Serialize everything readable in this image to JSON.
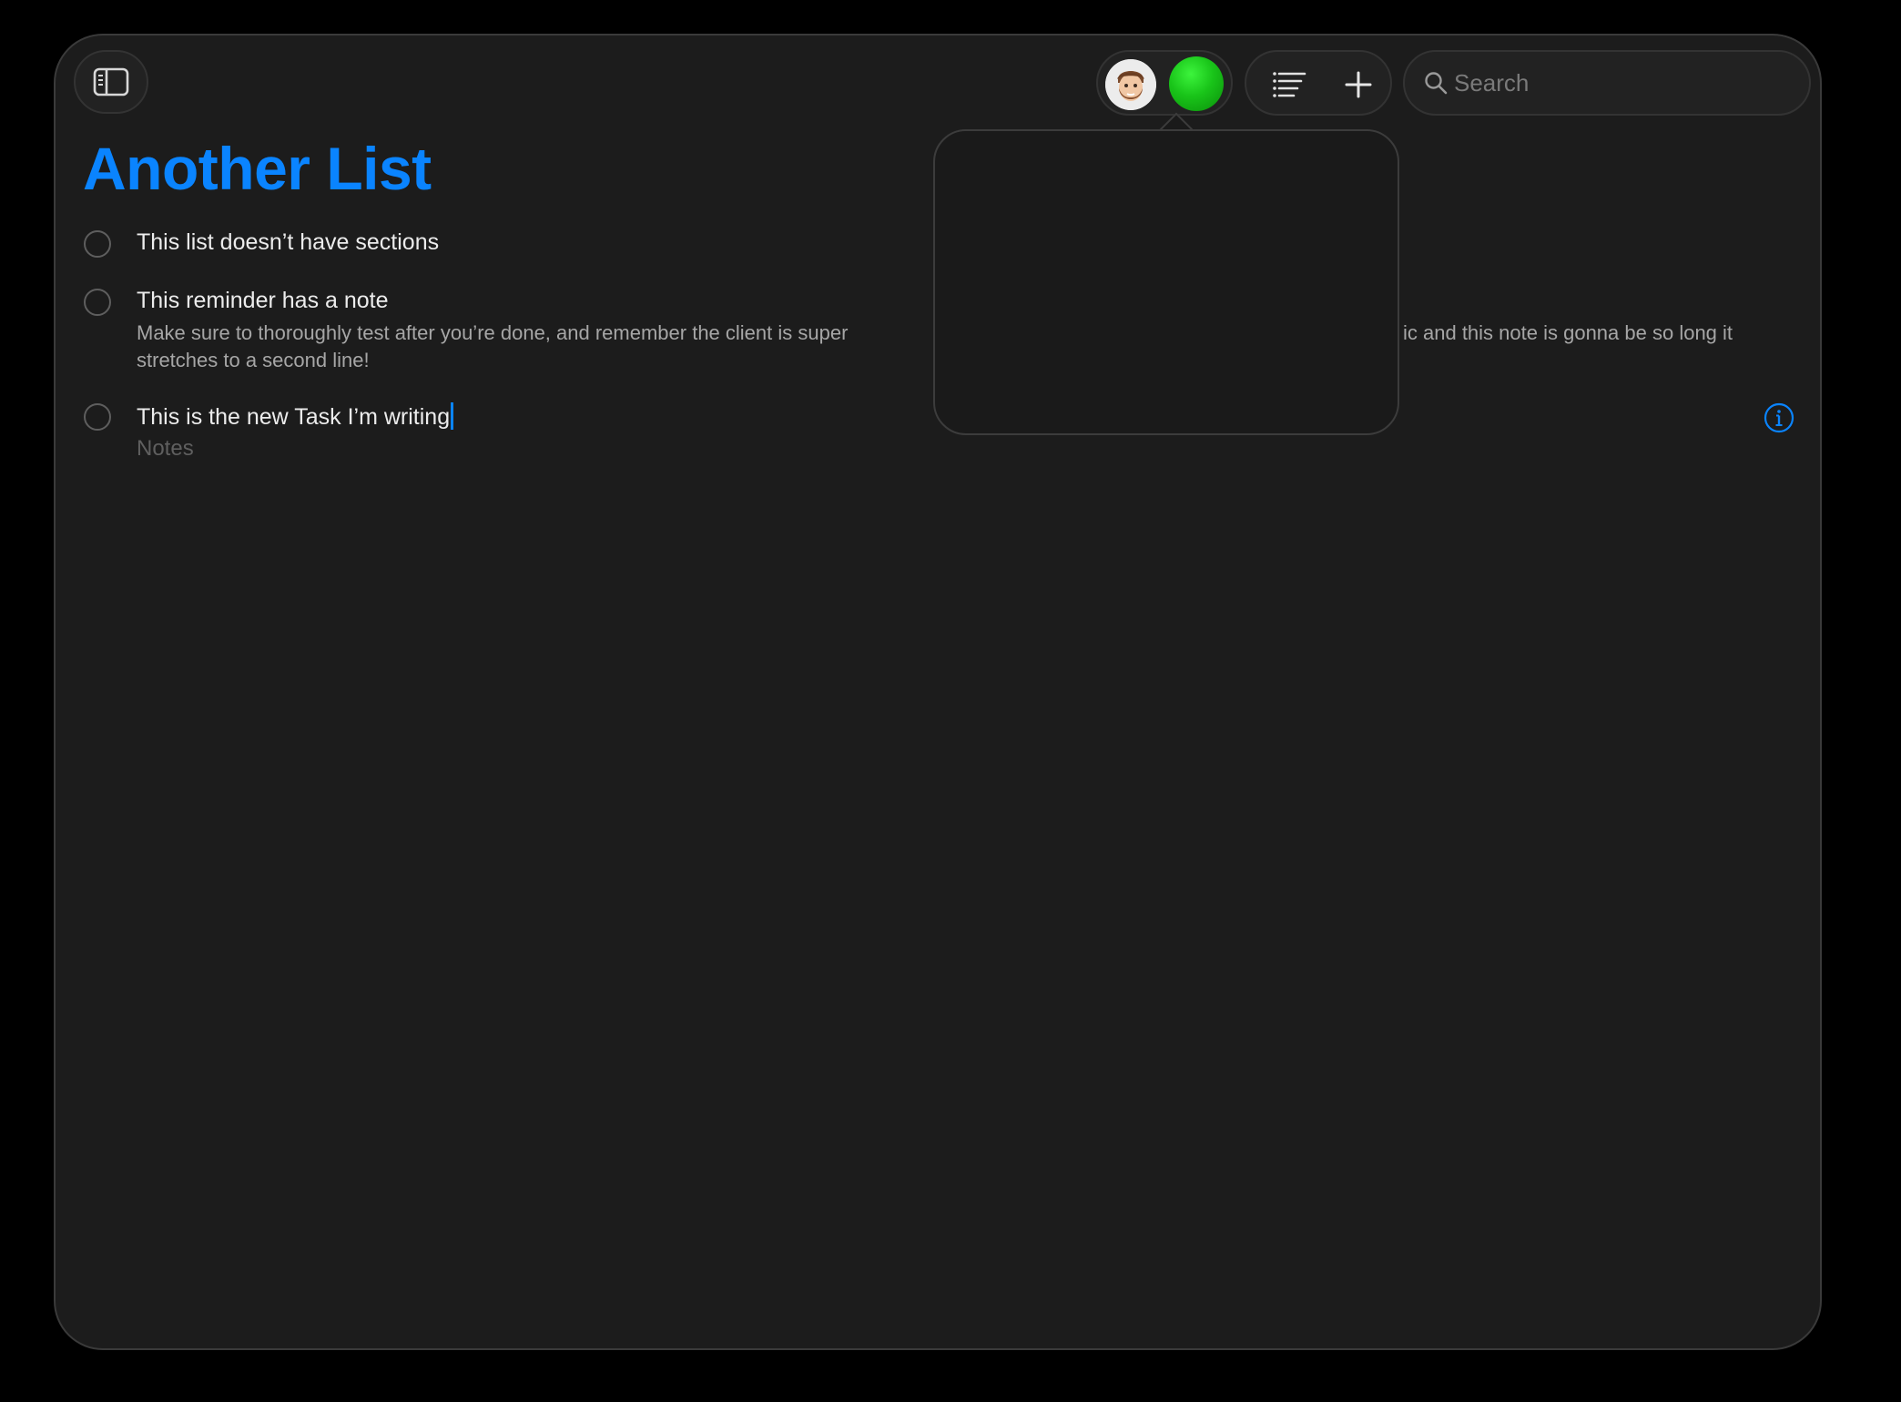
{
  "toolbar": {
    "sidebar_toggle_icon": "sidebar-icon",
    "list_options_icon": "list-options-icon",
    "add_icon": "plus-icon",
    "collaborators": [
      {
        "icon": "memoji-avatar"
      },
      {
        "icon": "green-dot-avatar",
        "color": "#19c419"
      }
    ],
    "search_placeholder": "Search",
    "search_value": ""
  },
  "list": {
    "title": "Another List",
    "accent_color": "#0a84ff",
    "tasks": [
      {
        "title": "This list doesn’t have sections",
        "note": ""
      },
      {
        "title": "This reminder has a note",
        "note_visible_start": "Make sure to thoroughly test after you’re done, and remember the client is super",
        "note_visible_end": "ic and this note is gonna be so long it",
        "note_line2": "stretches to a second line!"
      },
      {
        "title": "This is the new Task I’m writing",
        "note_placeholder": "Notes",
        "editing": true
      }
    ]
  }
}
